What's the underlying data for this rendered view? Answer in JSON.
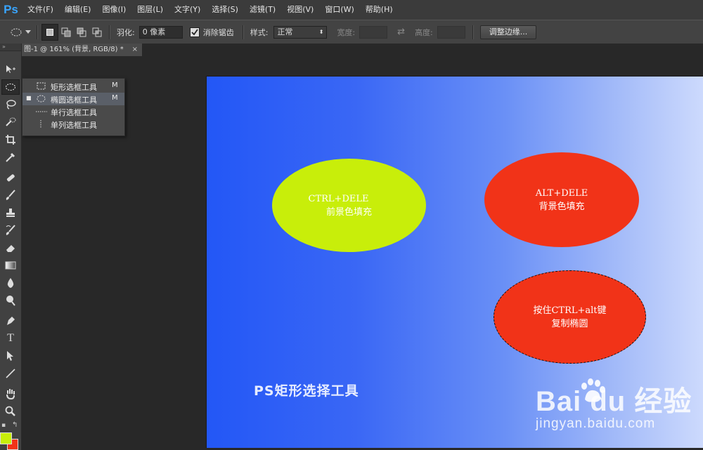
{
  "app": {
    "logo": "Ps"
  },
  "menu": [
    {
      "label": "文件(F)"
    },
    {
      "label": "编辑(E)"
    },
    {
      "label": "图像(I)"
    },
    {
      "label": "图层(L)"
    },
    {
      "label": "文字(Y)"
    },
    {
      "label": "选择(S)"
    },
    {
      "label": "滤镜(T)"
    },
    {
      "label": "视图(V)"
    },
    {
      "label": "窗口(W)"
    },
    {
      "label": "帮助(H)"
    }
  ],
  "options": {
    "feather_label": "羽化:",
    "feather_value": "0 像素",
    "antialias_label": "消除锯齿",
    "antialias_checked": true,
    "style_label": "样式:",
    "style_value": "正常",
    "width_label": "宽度:",
    "height_label": "高度:",
    "refine_edge_button": "调整边缘..."
  },
  "document_tab": {
    "title": "图-1 @ 161% (背景, RGB/8) *",
    "close": "×"
  },
  "toolbox": {
    "header": "»"
  },
  "flyout": [
    {
      "label": "矩形选框工具",
      "key": "M",
      "selected": false,
      "icon": "rect-marquee-icon"
    },
    {
      "label": "椭圆选框工具",
      "key": "M",
      "selected": true,
      "icon": "ellipse-marquee-icon"
    },
    {
      "label": "单行选框工具",
      "key": "",
      "selected": false,
      "icon": "single-row-marquee-icon"
    },
    {
      "label": "单列选框工具",
      "key": "",
      "selected": false,
      "icon": "single-column-marquee-icon"
    }
  ],
  "canvas": {
    "ellipse1": {
      "line1": "CTRL+DELE",
      "line2": "前景色填充",
      "color": "#c8ee0a"
    },
    "ellipse2": {
      "line1": "ALT+DELE",
      "line2": "背景色填充",
      "color": "#f13318"
    },
    "ellipse3": {
      "line1": "按住CTRL+alt键",
      "line2": "复制椭圆",
      "color": "#f13318"
    },
    "title": "PS矩形选择工具",
    "watermark_brand": "Bai  du 经验",
    "watermark_url": "jingyan.baidu.com"
  },
  "colors": {
    "foreground": "#c8ee0a",
    "background": "#f13318"
  }
}
